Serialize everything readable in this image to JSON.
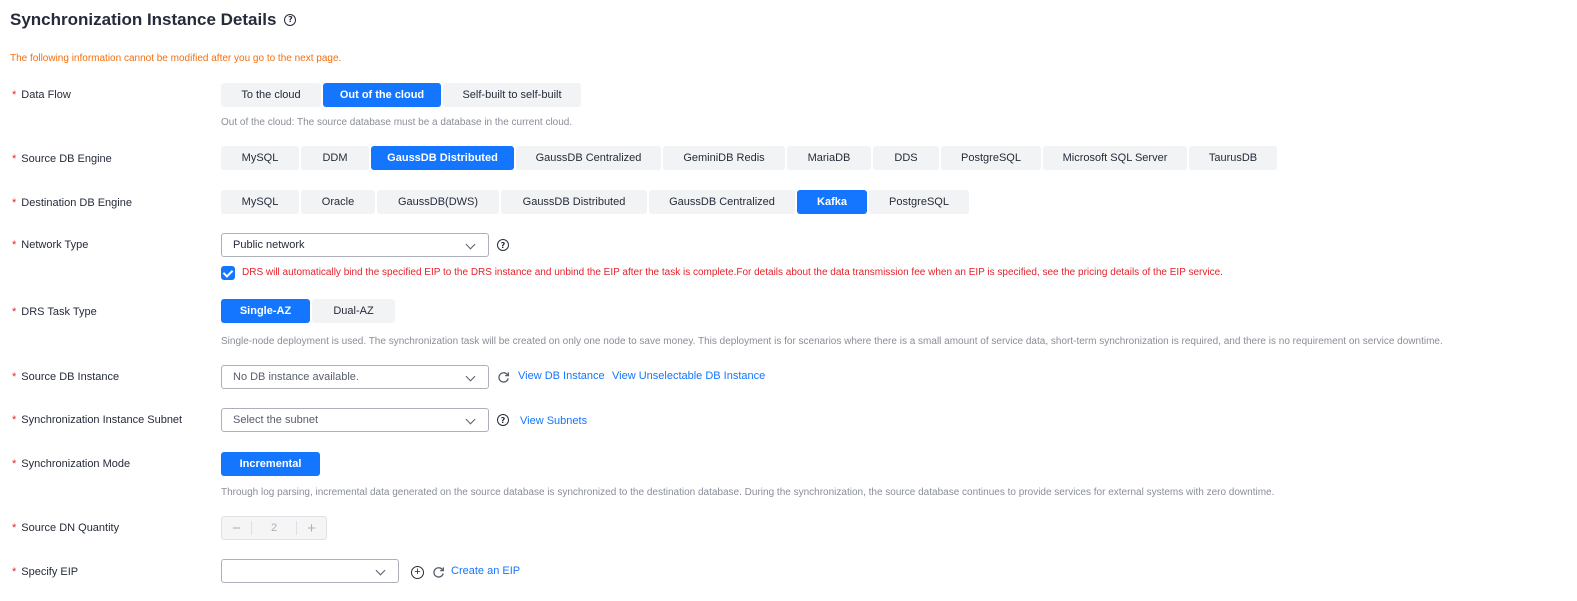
{
  "page": {
    "title": "Synchronization Instance Details",
    "help_icon": "question-circle-icon"
  },
  "warning": "The following information cannot be modified after you go to the next page.",
  "required_mark": "*",
  "data_flow": {
    "label": "Data Flow",
    "options": [
      "To the cloud",
      "Out of the cloud",
      "Self-built to self-built"
    ],
    "selected": "Out of the cloud",
    "hint": "Out of the cloud: The source database must be a database in the current cloud."
  },
  "source_engine": {
    "label": "Source DB Engine",
    "options": [
      "MySQL",
      "DDM",
      "GaussDB Distributed",
      "GaussDB Centralized",
      "GeminiDB Redis",
      "MariaDB",
      "DDS",
      "PostgreSQL",
      "Microsoft SQL Server",
      "TaurusDB"
    ],
    "selected": "GaussDB Distributed"
  },
  "dest_engine": {
    "label": "Destination DB Engine",
    "options": [
      "MySQL",
      "Oracle",
      "GaussDB(DWS)",
      "GaussDB Distributed",
      "GaussDB Centralized",
      "Kafka",
      "PostgreSQL"
    ],
    "selected": "Kafka"
  },
  "network_type": {
    "label": "Network Type",
    "value": "Public network",
    "checkbox_checked": true,
    "checkbox_note": "DRS will automatically bind the specified EIP to the DRS instance and unbind the EIP after the task is complete.For details about the data transmission fee when an EIP is specified, see the pricing details of the EIP service."
  },
  "task_type": {
    "label": "DRS Task Type",
    "options": [
      "Single-AZ",
      "Dual-AZ"
    ],
    "selected": "Single-AZ",
    "hint": "Single-node deployment is used. The synchronization task will be created on only one node to save money. This deployment is for scenarios where there is a small amount of service data, short-term synchronization is required, and there is no requirement on service downtime."
  },
  "source_instance": {
    "label": "Source DB Instance",
    "placeholder": "No DB instance available.",
    "link_view": "View DB Instance",
    "link_unselectable": "View Unselectable DB Instance"
  },
  "subnet": {
    "label": "Synchronization Instance Subnet",
    "placeholder": "Select the subnet",
    "link": "View Subnets"
  },
  "sync_mode": {
    "label": "Synchronization Mode",
    "options": [
      "Incremental"
    ],
    "selected": "Incremental",
    "hint": "Through log parsing, incremental data generated on the source database is synchronized to the destination database. During the synchronization, the source database continues to provide services for external systems with zero downtime."
  },
  "dn_quantity": {
    "label": "Source DN Quantity",
    "value": "2",
    "minus": "−",
    "plus": "+"
  },
  "eip": {
    "label": "Specify EIP",
    "value": "",
    "link": "Create an EIP"
  },
  "colors": {
    "accent": "#1476ff",
    "required": "#e7212a",
    "warning": "#f66f0e"
  }
}
